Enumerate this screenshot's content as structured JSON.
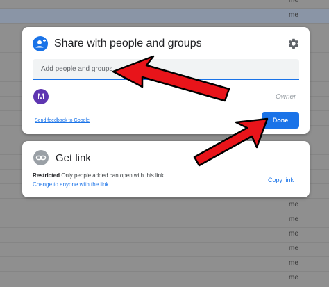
{
  "background": {
    "owner_label": "me",
    "row_count": 20
  },
  "share_dialog": {
    "title": "Share with people and groups",
    "add_placeholder": "Add people and groups",
    "user_initial": "M",
    "owner_label": "Owner",
    "feedback_link": "Send feedback to Google",
    "done_label": "Done"
  },
  "get_link": {
    "title": "Get link",
    "restricted_label": "Restricted",
    "restricted_desc": "Only people added can open with this link",
    "change_link": "Change to anyone with the link",
    "copy_label": "Copy link"
  },
  "icons": {
    "share": "person-add-icon",
    "settings": "gear-icon",
    "link": "link-icon"
  },
  "colors": {
    "accent": "#1a73e8",
    "avatar": "#5e35b1",
    "arrow": "#e8141a"
  }
}
